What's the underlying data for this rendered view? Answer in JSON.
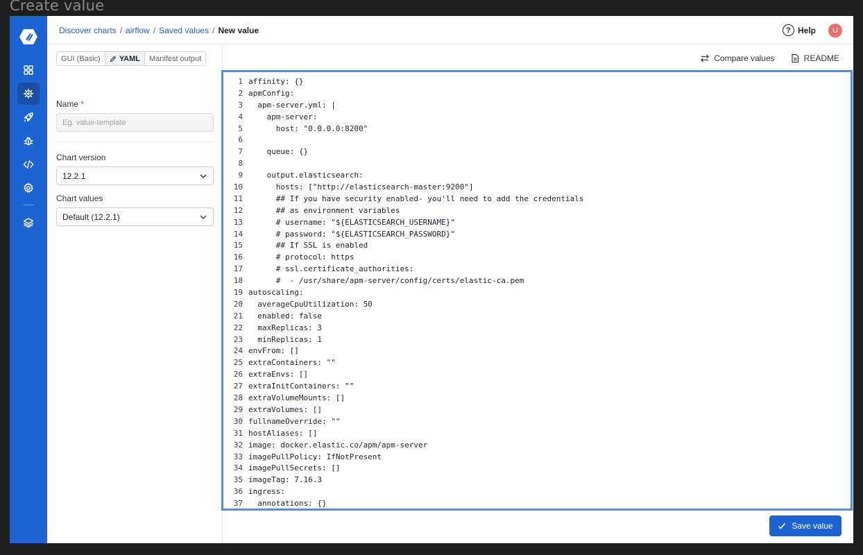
{
  "window": {
    "title": "Create value"
  },
  "colors": {
    "nav": "#1e63d3",
    "accent": "#1e63d3",
    "avatar": "#f26b6b",
    "editor_border": "#4a90e8"
  },
  "nav": {
    "items": [
      {
        "name": "dashboard-grid-icon"
      },
      {
        "name": "helm-wheel-icon",
        "active": true
      },
      {
        "name": "rocket-icon"
      },
      {
        "name": "bug-icon"
      },
      {
        "name": "code-icon"
      },
      {
        "name": "gear-icon"
      },
      {
        "name": "layers-icon"
      }
    ]
  },
  "breadcrumb": {
    "items": [
      "Discover charts",
      "airflow",
      "Saved values"
    ],
    "separator": "/",
    "current": "New value"
  },
  "header": {
    "help_label": "Help",
    "help_glyph": "?",
    "avatar_initial": "U"
  },
  "tabs": {
    "gui_basic": "GUI (Basic)",
    "yaml": "YAML",
    "manifest": "Manifest output"
  },
  "form": {
    "name_label": "Name",
    "required_mark": "*",
    "name_placeholder": "Eg. value-template",
    "chart_version_label": "Chart version",
    "chart_version_value": "12.2.1",
    "chart_values_label": "Chart values",
    "chart_values_value": "Default (12.2.1)"
  },
  "actions": {
    "compare": "Compare values",
    "readme": "README"
  },
  "editor": {
    "lines": [
      "affinity: {}",
      "apmConfig:",
      "  apm-server.yml: |",
      "    apm-server:",
      "      host: \"0.0.0.0:8200\"",
      "",
      "    queue: {}",
      "",
      "    output.elasticsearch:",
      "      hosts: [\"http://elasticsearch-master:9200\"]",
      "      ## If you have security enabled- you'll need to add the credentials",
      "      ## as environment variables",
      "      # username: \"${ELASTICSEARCH_USERNAME}\"",
      "      # password: \"${ELASTICSEARCH_PASSWORD}\"",
      "      ## If SSL is enabled",
      "      # protocol: https",
      "      # ssl.certificate_authorities:",
      "      #  - /usr/share/apm-server/config/certs/elastic-ca.pem",
      "autoscaling:",
      "  averageCpuUtilization: 50",
      "  enabled: false",
      "  maxReplicas: 3",
      "  minReplicas: 1",
      "envFrom: []",
      "extraContainers: \"\"",
      "extraEnvs: []",
      "extraInitContainers: \"\"",
      "extraVolumeMounts: []",
      "extraVolumes: []",
      "fullnameOverride: \"\"",
      "hostAliases: []",
      "image: docker.elastic.co/apm/apm-server",
      "imagePullPolicy: IfNotPresent",
      "imagePullSecrets: []",
      "imageTag: 7.16.3",
      "ingress:",
      "  annotations: {}"
    ]
  },
  "footer": {
    "save_label": "Save value"
  }
}
